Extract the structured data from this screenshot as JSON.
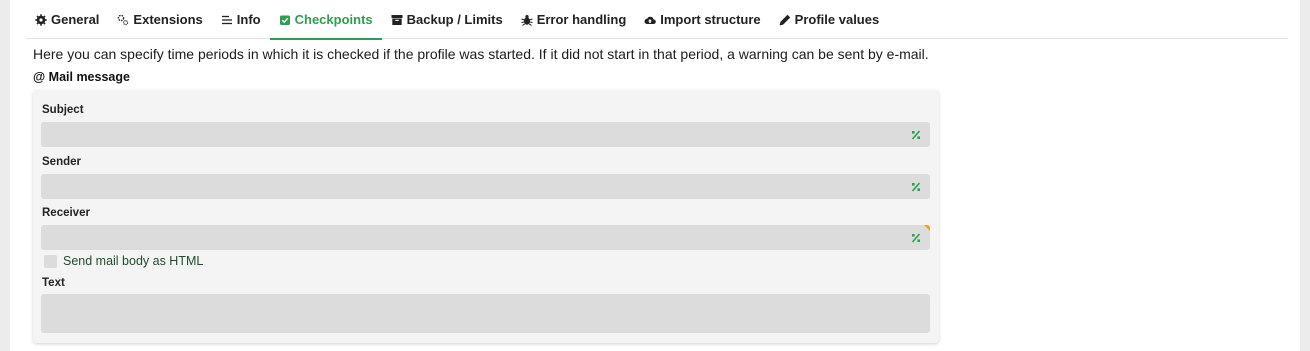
{
  "tabs": [
    {
      "label": "General",
      "icon": "gear-icon"
    },
    {
      "label": "Extensions",
      "icon": "extensions-icon"
    },
    {
      "label": "Info",
      "icon": "info-list-icon"
    },
    {
      "label": "Checkpoints",
      "icon": "checkpoint-icon",
      "active": true
    },
    {
      "label": "Backup / Limits",
      "icon": "archive-icon"
    },
    {
      "label": "Error handling",
      "icon": "bug-icon"
    },
    {
      "label": "Import structure",
      "icon": "cloud-upload-icon"
    },
    {
      "label": "Profile values",
      "icon": "pencil-icon"
    }
  ],
  "intro_text": "Here you can specify time periods in which it is checked if the profile was started. If it did not start in that period, a warning can be sent by e-mail.",
  "mail_section": {
    "title": "@ Mail message",
    "subject_label": "Subject",
    "subject_value": "",
    "sender_label": "Sender",
    "sender_value": "",
    "receiver_label": "Receiver",
    "receiver_value": "",
    "html_checkbox_label": "Send mail body as HTML",
    "html_checkbox_checked": false,
    "text_label": "Text",
    "text_value": ""
  },
  "colors": {
    "accent": "#2e9e50",
    "required_marker": "#f0a020",
    "field_bg": "#dcdcdc"
  }
}
